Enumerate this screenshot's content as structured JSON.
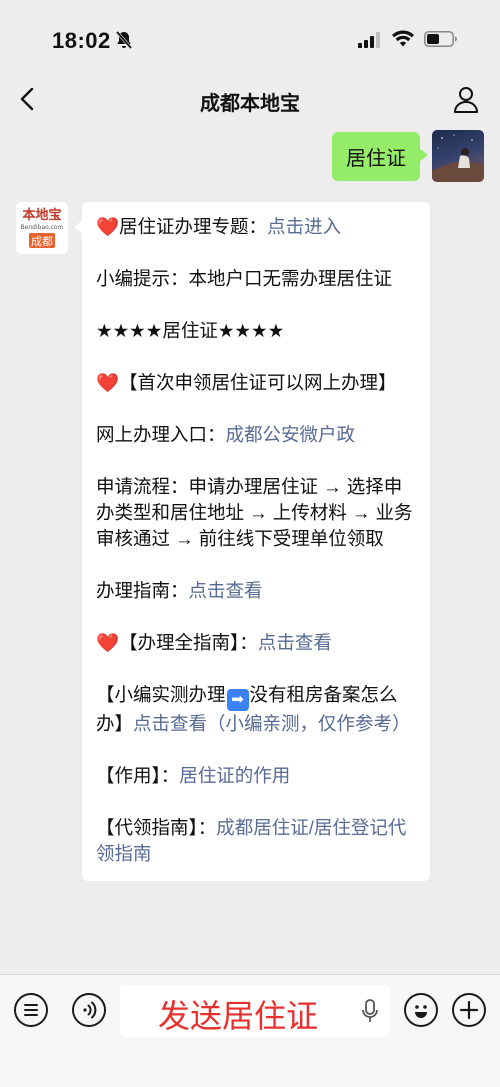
{
  "status_bar": {
    "time": "18:02",
    "icons": [
      "bell-muted-icon",
      "signal-icon",
      "wifi-icon",
      "battery-icon"
    ]
  },
  "nav": {
    "title": "成都本地宝",
    "back_icon": "chevron-left-icon",
    "profile_icon": "person-icon"
  },
  "sent_message": {
    "text": "居住证"
  },
  "bot_avatar": {
    "logo_text": "本地宝",
    "logo_domain": "Bendibao.com",
    "city": "成都"
  },
  "received_message": {
    "p1_text": "居住证办理专题：",
    "p1_link": "点击进入",
    "p2_text": "小编提示：本地户口无需办理居住证",
    "p3_text": "★★★★居住证★★★★",
    "p4_text": "【首次申领居住证可以网上办理】",
    "p5_text": "网上办理入口：",
    "p5_link": "成都公安微户政",
    "p6_text": "申请流程：申请办理居住证 → 选择申办类型和居住地址 → 上传材料 → 业务审核通过 → 前往线下受理单位领取",
    "p7_text": "办理指南：",
    "p7_link": "点击查看",
    "p8_text": "【办理全指南】：",
    "p8_link": "点击查看",
    "p9_text_a": "【小编实测办理",
    "p9_arrow": "➡",
    "p9_text_b": "没有租房备案怎么办】",
    "p9_link": "点击查看（小编亲测，仅作参考）",
    "p10_text": "【作用】：",
    "p10_link": "居住证的作用",
    "p11_text": "【代领指南】：",
    "p11_link": "成都居住证/居住登记代领指南"
  },
  "input_bar": {
    "text_value": "发送居住证",
    "left_buttons": [
      "menu-icon",
      "voice-icon"
    ],
    "right_buttons": [
      "emoji-icon",
      "plus-icon"
    ]
  },
  "colors": {
    "background": "#ededed",
    "sent_bubble": "#95ec69",
    "link": "#576b95",
    "heart": "#e0262c",
    "input_text": "#e8312f"
  }
}
